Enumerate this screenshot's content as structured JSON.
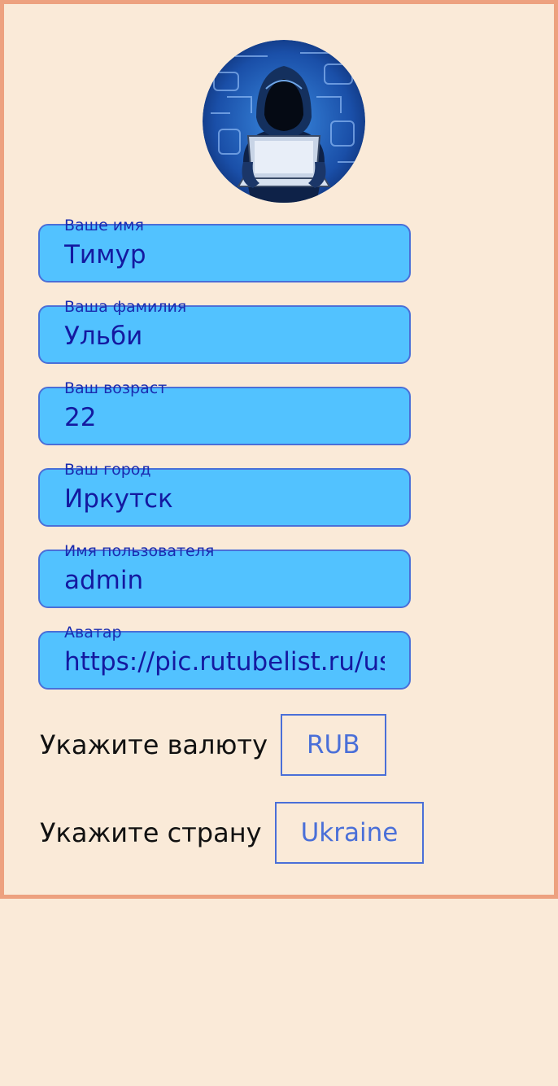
{
  "profile": {
    "avatar_alt": "hacker-avatar",
    "fields": [
      {
        "label": "Ваше имя",
        "value": "Тимур"
      },
      {
        "label": "Ваша фамилия",
        "value": "Ульби"
      },
      {
        "label": "Ваш возраст",
        "value": "22"
      },
      {
        "label": "Ваш город",
        "value": "Иркутск"
      },
      {
        "label": "Имя пользователя",
        "value": "admin"
      },
      {
        "label": "Аватар",
        "value": "https://pic.rutubelist.ru/us"
      }
    ],
    "currency": {
      "label": "Укажите валюту",
      "value": "RUB"
    },
    "country": {
      "label": "Укажите страну",
      "value": "Ukraine"
    }
  },
  "colors": {
    "background": "#faead8",
    "border": "#eda17f",
    "field_bg": "#52c2ff",
    "accent": "#4a6fd8",
    "field_text": "#1419a0"
  }
}
